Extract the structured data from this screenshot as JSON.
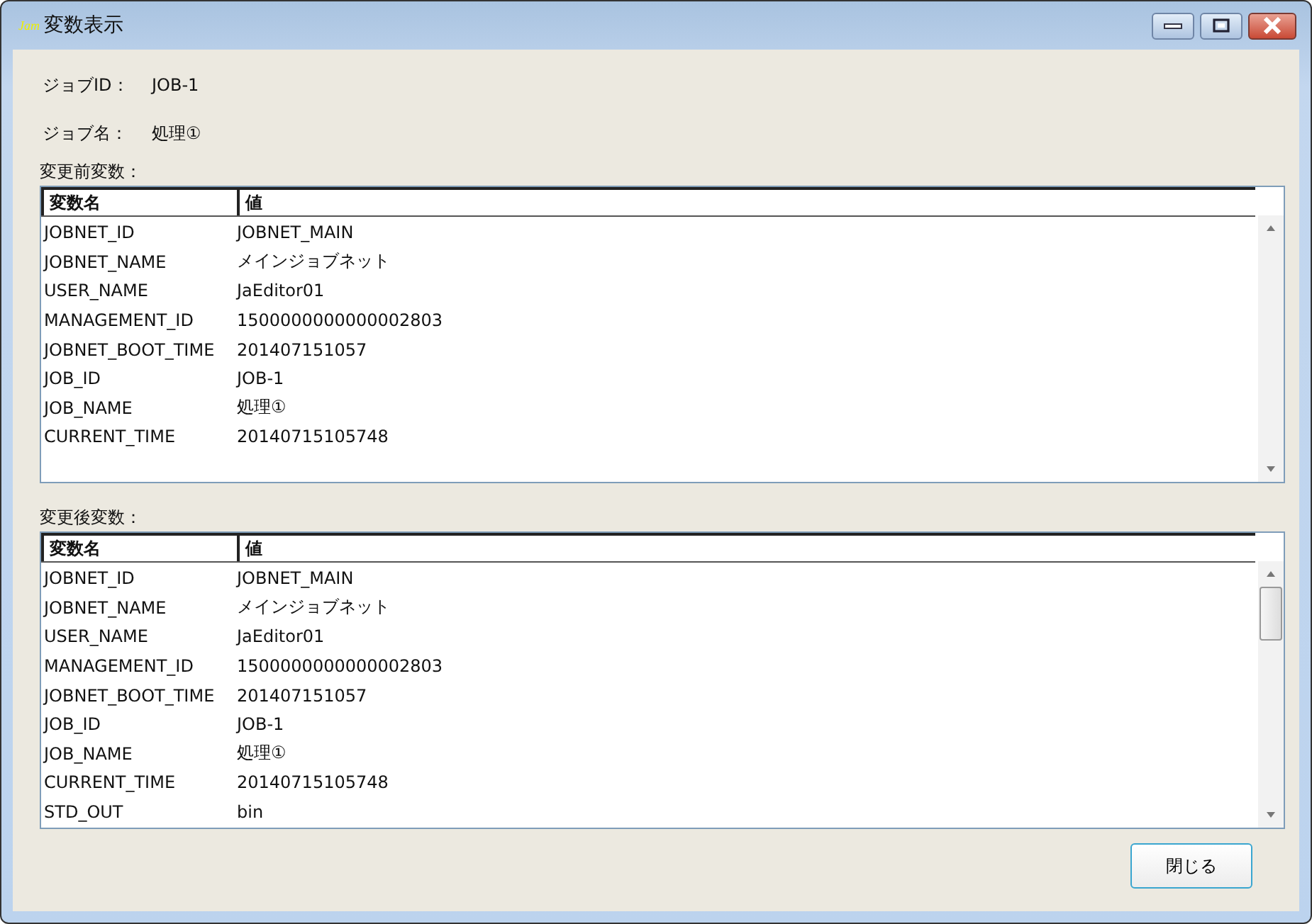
{
  "window": {
    "app_badge": "Jam",
    "title": "変数表示"
  },
  "fields": [
    {
      "label": "ジョブID：",
      "value": "JOB-1"
    },
    {
      "label": "ジョブ名：",
      "value": "処理①"
    }
  ],
  "tables": [
    {
      "label": "変更前変数：",
      "columns": [
        "変数名",
        "値"
      ],
      "rows": [
        [
          "JOBNET_ID",
          "JOBNET_MAIN"
        ],
        [
          "JOBNET_NAME",
          "メインジョブネット"
        ],
        [
          "USER_NAME",
          "JaEditor01"
        ],
        [
          "MANAGEMENT_ID",
          "1500000000000002803"
        ],
        [
          "JOBNET_BOOT_TIME",
          "201407151057"
        ],
        [
          "JOB_ID",
          "JOB-1"
        ],
        [
          "JOB_NAME",
          "処理①"
        ],
        [
          "CURRENT_TIME",
          "20140715105748"
        ]
      ]
    },
    {
      "label": "変更後変数：",
      "columns": [
        "変数名",
        "値"
      ],
      "rows": [
        [
          "JOBNET_ID",
          "JOBNET_MAIN"
        ],
        [
          "JOBNET_NAME",
          "メインジョブネット"
        ],
        [
          "USER_NAME",
          "JaEditor01"
        ],
        [
          "MANAGEMENT_ID",
          "1500000000000002803"
        ],
        [
          "JOBNET_BOOT_TIME",
          "201407151057"
        ],
        [
          "JOB_ID",
          "JOB-1"
        ],
        [
          "JOB_NAME",
          "処理①"
        ],
        [
          "CURRENT_TIME",
          "20140715105748"
        ],
        [
          "STD_OUT",
          "bin"
        ]
      ]
    }
  ],
  "buttons": [
    "閉じる"
  ]
}
